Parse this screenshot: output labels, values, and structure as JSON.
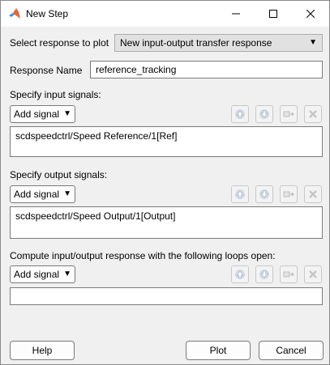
{
  "window": {
    "title": "New Step",
    "app_icon": "matlab-logo-icon",
    "controls": [
      "minimize-icon",
      "maximize-icon",
      "close-icon"
    ]
  },
  "response": {
    "label": "Select response to plot",
    "selected": "New input-output transfer response"
  },
  "name": {
    "label": "Response Name",
    "value": "reference_tracking"
  },
  "inputs": {
    "label": "Specify input signals:",
    "add_label": "Add signal",
    "items": [
      "scdspeedctrl/Speed Reference/1[Ref]"
    ]
  },
  "outputs": {
    "label": "Specify output signals:",
    "add_label": "Add signal",
    "items": [
      "scdspeedctrl/Speed Output/1[Output]"
    ]
  },
  "loops": {
    "label": "Compute input/output response with the following loops open:",
    "add_label": "Add signal",
    "value": ""
  },
  "list_tools": [
    "move-up-icon",
    "move-down-icon",
    "highlight-signal-icon",
    "delete-icon"
  ],
  "footer": {
    "help": "Help",
    "plot": "Plot",
    "cancel": "Cancel"
  }
}
